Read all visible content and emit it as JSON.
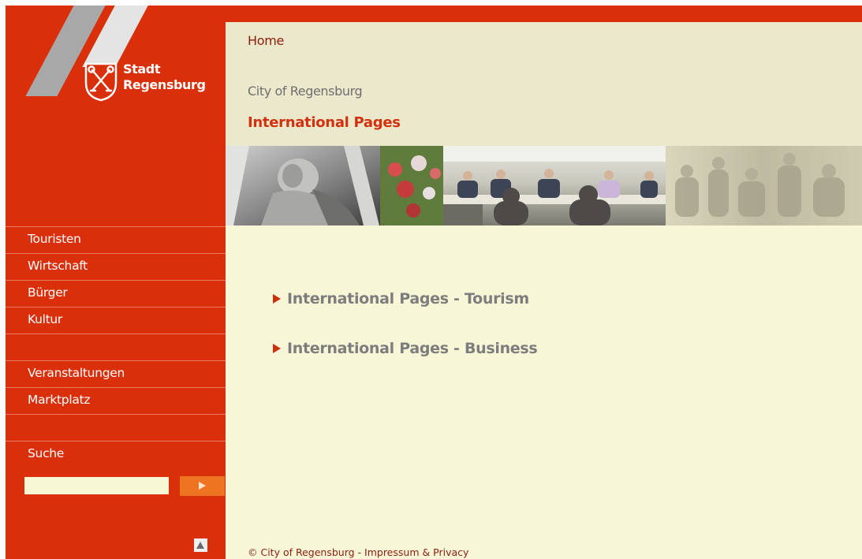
{
  "logo": {
    "line1": "Stadt",
    "line2": "Regensburg"
  },
  "nav": {
    "items": [
      {
        "label": "Touristen"
      },
      {
        "label": "Wirtschaft"
      },
      {
        "label": "Bürger"
      },
      {
        "label": "Kultur"
      },
      {
        "label": ""
      },
      {
        "label": "Veranstaltungen"
      },
      {
        "label": "Marktplatz"
      },
      {
        "label": ""
      },
      {
        "label": "Suche"
      }
    ]
  },
  "search": {
    "value": "",
    "placeholder": ""
  },
  "header": {
    "breadcrumb": "Home",
    "site_name": "City of Regensburg",
    "title": "International Pages"
  },
  "content": {
    "links": [
      {
        "label": "International Pages - Tourism"
      },
      {
        "label": "International Pages - Business"
      }
    ]
  },
  "footer": {
    "copyright": "© City of Regensburg - ",
    "imprint_link": "Impressum & Privacy"
  },
  "colors": {
    "brand_red": "#d92f0a",
    "header_beige": "#ebe8cb",
    "content_cream": "#f7f7d8",
    "search_button_orange": "#ee7422"
  },
  "icons": [
    "coat-of-arms-icon",
    "play-arrow-icon",
    "back-to-top-icon",
    "link-arrow-icon"
  ]
}
